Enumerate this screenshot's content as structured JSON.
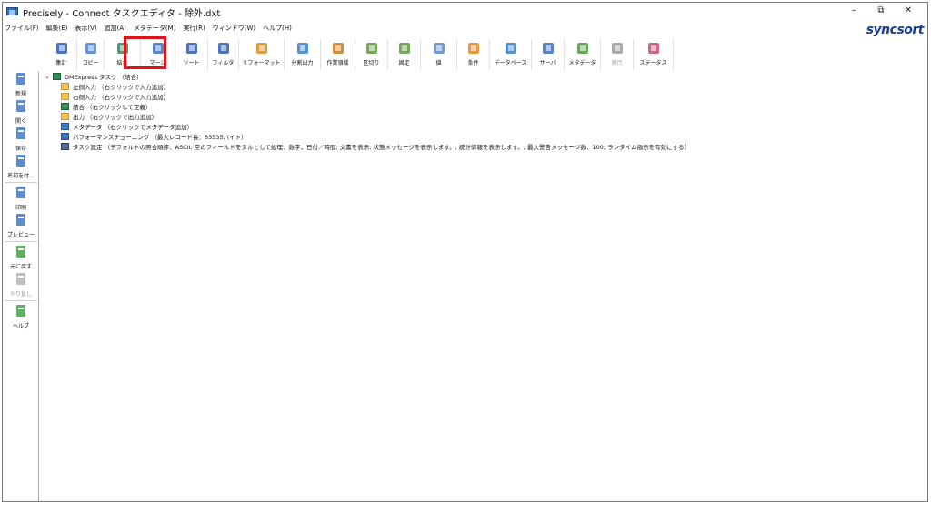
{
  "window": {
    "title": "Precisely - Connect タスクエディタ - 除外.dxt",
    "controls": [
      "–",
      "⧉",
      "✕"
    ]
  },
  "brand": "syncsort",
  "menubar": [
    "ファイル(F)",
    "編集(E)",
    "表示(V)",
    "追加(A)",
    "メタデータ(M)",
    "実行(R)",
    "ウィンドウ(W)",
    "ヘルプ(H)"
  ],
  "toolbar": [
    {
      "label": "集計",
      "icon": "sigma-icon",
      "color": "#2a5db0"
    },
    {
      "label": "コピー",
      "icon": "copy-icon",
      "color": "#4a7fc8"
    },
    {
      "label": "結合",
      "icon": "join-icon",
      "color": "#2e8b57",
      "highlighted": true
    },
    {
      "label": "マージ",
      "icon": "merge-icon",
      "color": "#3a6fbf"
    },
    {
      "label": "ソート",
      "icon": "sort-icon",
      "color": "#2a5db0"
    },
    {
      "label": "フィルタ",
      "icon": "filter-icon",
      "color": "#2a5db0"
    },
    {
      "label": "リフォーマット",
      "icon": "reformat-icon",
      "color": "#d88a1e"
    },
    {
      "label": "分割出力",
      "icon": "split-output-icon",
      "color": "#3a7fc8"
    },
    {
      "label": "作業領域",
      "icon": "work-area-icon",
      "color": "#c97a1a"
    },
    {
      "label": "区切り",
      "icon": "delimiter-icon",
      "color": "#5a9a3a"
    },
    {
      "label": "固定",
      "icon": "fixed-icon",
      "color": "#5a9a3a"
    },
    {
      "label": "値",
      "icon": "value-icon",
      "color": "#5a8ac8"
    },
    {
      "label": "条件",
      "icon": "condition-icon",
      "color": "#e08a1e"
    },
    {
      "label": "データベース",
      "icon": "database-icon",
      "color": "#3a7fc8"
    },
    {
      "label": "サーバ",
      "icon": "server-icon",
      "color": "#3a6fbf"
    },
    {
      "label": "メタデータ",
      "icon": "metadata-icon",
      "color": "#4a9a3a"
    },
    {
      "label": "実行",
      "icon": "run-icon",
      "color": "#9a9a9a",
      "disabled": true
    },
    {
      "label": "ステータス",
      "icon": "status-icon",
      "color": "#c84a6a"
    }
  ],
  "sidebar": [
    {
      "label": "新規",
      "icon": "new-file-icon",
      "group": 1
    },
    {
      "label": "開く",
      "icon": "open-folder-icon",
      "group": 1
    },
    {
      "label": "保存",
      "icon": "save-icon",
      "group": 1
    },
    {
      "label": "名前を付...",
      "icon": "save-as-icon",
      "group": 1
    },
    {
      "label": "印刷",
      "icon": "print-icon",
      "group": 2
    },
    {
      "label": "プレビュー",
      "icon": "preview-icon",
      "group": 2
    },
    {
      "label": "元に戻す",
      "icon": "undo-icon",
      "group": 3
    },
    {
      "label": "やり直し",
      "icon": "redo-icon",
      "group": 3,
      "disabled": true
    },
    {
      "label": "ヘルプ",
      "icon": "help-icon",
      "group": 4
    }
  ],
  "tree": {
    "root": "DMExpress タスク （結合）",
    "items": [
      {
        "icon": "folder-icon",
        "text": "左側入力 （右クリックで入力追加）"
      },
      {
        "icon": "folder-icon",
        "text": "右側入力 （右クリックで入力追加）"
      },
      {
        "icon": "join-node-icon",
        "text": "結合 （右クリックして定義）"
      },
      {
        "icon": "folder-icon",
        "text": "出力 （右クリックで出力追加）"
      },
      {
        "icon": "metadata-node-icon",
        "text": "メタデータ （右クリックでメタデータ追加）"
      },
      {
        "icon": "tuning-icon",
        "text": "パフォーマンスチューニング （最大レコード長：65535バイト）"
      },
      {
        "icon": "task-settings-icon",
        "text": "タスク設定 （デフォルトの照合順序：ASCII; 空のフィールドをヌルとして処理：数字，日付／時間; 文書を表示; 状態メッセージを表示します。; 統計情報を表示します。; 最大警告メッセージ数：100; ランタイム指示を有効にする）"
      }
    ]
  }
}
